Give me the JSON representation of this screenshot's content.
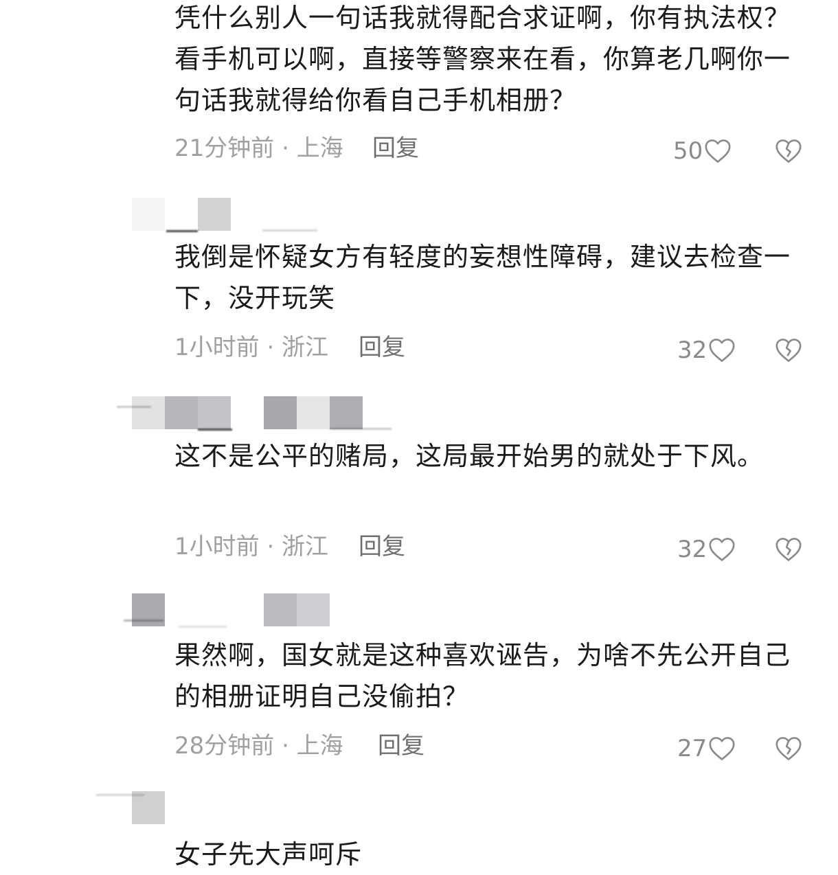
{
  "comments": [
    {
      "text": "凭什么别人一句话我就得配合求证啊，你有执法权？看手机可以啊，直接等警察来在看，你算老几啊你一句话我就得给你看自己手机相册？",
      "time_location": "21分钟前 · 上海",
      "reply_label": "回复",
      "likes": "50"
    },
    {
      "text": "我倒是怀疑女方有轻度的妄想性障碍，建议去检查一下，没开玩笑",
      "time_location": "1小时前 · 浙江",
      "reply_label": "回复",
      "likes": "32"
    },
    {
      "text": "这不是公平的赌局，这局最开始男的就处于下风。",
      "time_location": "1小时前 · 浙江",
      "reply_label": "回复",
      "likes": "32"
    },
    {
      "text": "果然啊，国女就是这种喜欢诬告，为啥不先公开自己的相册证明自己没偷拍？",
      "time_location": "28分钟前 · 上海",
      "reply_label": "回复",
      "likes": "27"
    },
    {
      "text": "女子先大声呵斥",
      "time_location": "",
      "reply_label": "",
      "likes": ""
    }
  ],
  "icons": {
    "like": "heart-outline-icon",
    "dislike": "broken-heart-icon"
  },
  "colors": {
    "text": "#1a1a1a",
    "meta": "#a0a0a0",
    "icon": "#8a8a8a"
  }
}
